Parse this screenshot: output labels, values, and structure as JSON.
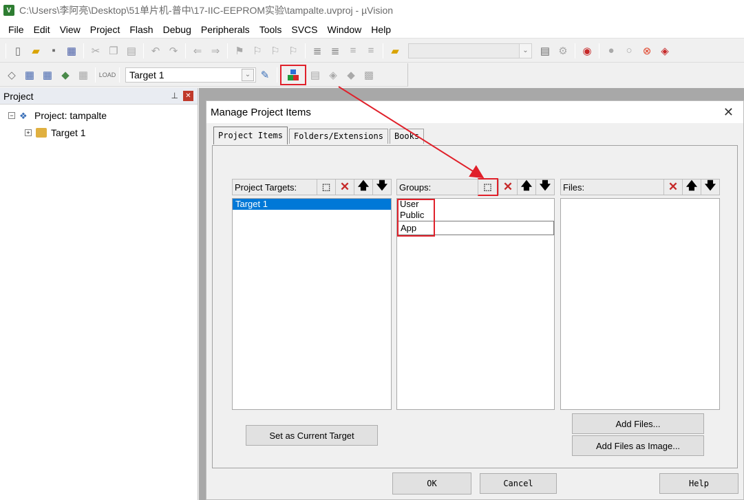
{
  "window": {
    "title": "C:\\Users\\李阿亮\\Desktop\\51单片机-普中\\17-IIC-EEPROM实验\\tampalte.uvproj - µVision",
    "app_icon_text": "V"
  },
  "menu": [
    "File",
    "Edit",
    "View",
    "Project",
    "Flash",
    "Debug",
    "Peripherals",
    "Tools",
    "SVCS",
    "Window",
    "Help"
  ],
  "toolbar2": {
    "target_combo": "Target 1"
  },
  "project_panel": {
    "title": "Project",
    "tree": [
      {
        "label": "Project: tampalte",
        "expander": "−"
      },
      {
        "label": "Target 1",
        "expander": "+"
      }
    ]
  },
  "dialog": {
    "title": "Manage Project Items",
    "tabs": [
      "Project Items",
      "Folders/Extensions",
      "Books"
    ],
    "targets": {
      "header": "Project Targets:",
      "items": [
        "Target 1"
      ]
    },
    "groups": {
      "header": "Groups:",
      "items": [
        "User",
        "Public"
      ],
      "editing": "App"
    },
    "files": {
      "header": "Files:",
      "items": []
    },
    "buttons": {
      "set_current": "Set as Current Target",
      "add_files": "Add Files...",
      "add_files_image": "Add Files as Image...",
      "ok": "OK",
      "cancel": "Cancel",
      "help": "Help"
    }
  },
  "colors": {
    "highlight": "#e0202a",
    "selection": "#0078d7"
  }
}
